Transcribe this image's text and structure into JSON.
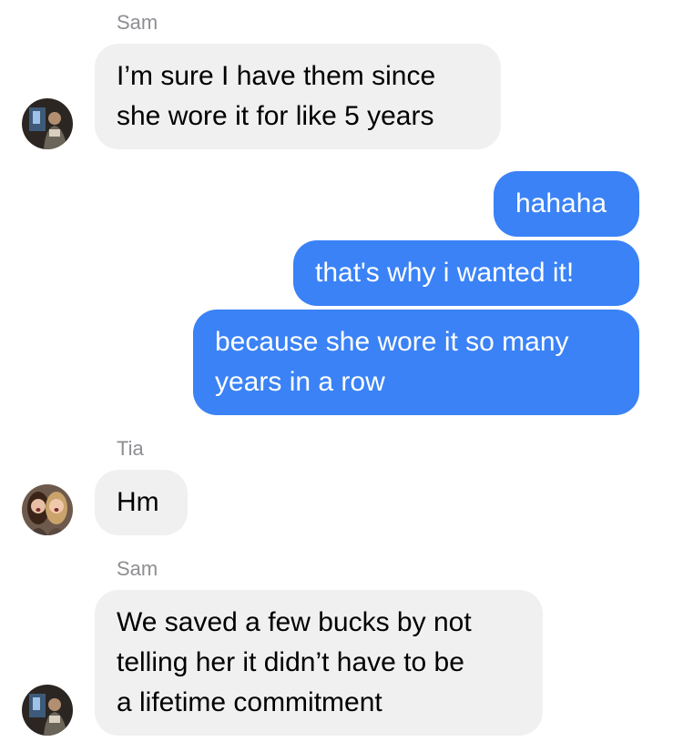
{
  "conversation": {
    "messages": [
      {
        "sender": "Sam",
        "direction": "incoming",
        "lines": [
          "I’m sure I have them since",
          "she wore it for like 5 years"
        ]
      },
      {
        "direction": "outgoing",
        "lines": [
          "hahaha"
        ]
      },
      {
        "direction": "outgoing",
        "lines": [
          "that's why i wanted it!"
        ]
      },
      {
        "direction": "outgoing",
        "lines": [
          "because she wore it so many",
          "years in a row"
        ]
      },
      {
        "sender": "Tia",
        "direction": "incoming",
        "lines": [
          "Hm"
        ]
      },
      {
        "sender": "Sam",
        "direction": "incoming",
        "lines": [
          "We saved a few bucks by not",
          "telling her it didn’t have to be",
          "a lifetime commitment"
        ]
      }
    ]
  },
  "colors": {
    "outgoing_bubble": "#3a82f6",
    "incoming_bubble": "#f0f0f0",
    "sender_name": "#8e8e93"
  }
}
